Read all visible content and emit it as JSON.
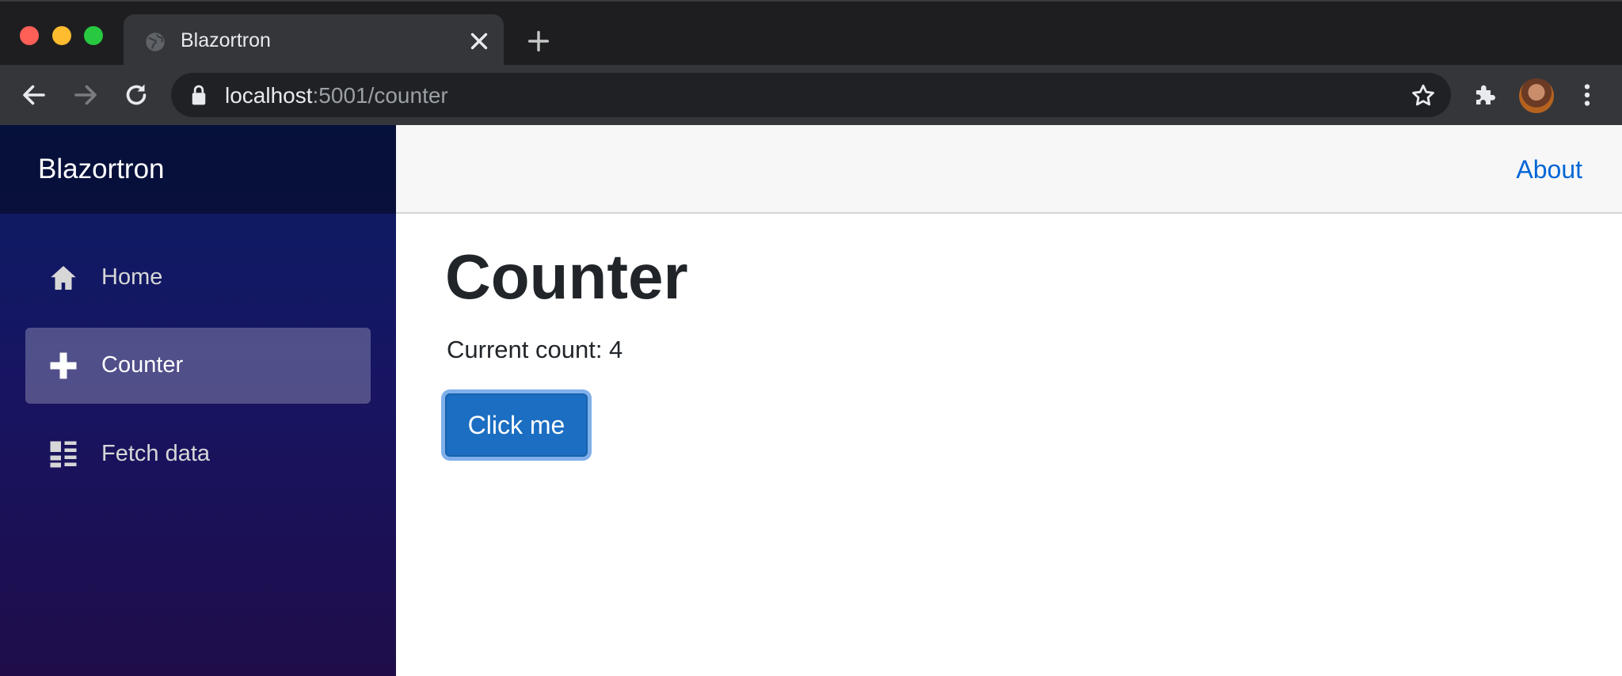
{
  "browser": {
    "tab_title": "Blazortron",
    "url_host": "localhost",
    "url_rest": ":5001/counter",
    "icons": {
      "favicon": "globe-icon",
      "close_tab": "close-icon",
      "new_tab": "plus-icon",
      "back": "arrow-left-icon",
      "forward": "arrow-right-icon",
      "reload": "reload-icon",
      "lock": "lock-icon",
      "bookmark": "star-icon",
      "extensions": "puzzle-icon",
      "menu": "kebab-menu-icon"
    }
  },
  "sidebar": {
    "brand": "Blazortron",
    "items": [
      {
        "label": "Home",
        "icon": "home-icon",
        "active": false
      },
      {
        "label": "Counter",
        "icon": "plus-icon",
        "active": true
      },
      {
        "label": "Fetch data",
        "icon": "list-icon",
        "active": false
      }
    ]
  },
  "topbar": {
    "about_label": "About"
  },
  "main": {
    "title": "Counter",
    "count_line": "Current count: 4",
    "button_label": "Click me"
  },
  "colors": {
    "accent": "#1b6ec2",
    "link": "#0366d6",
    "sidebar_top": "#0a1d63",
    "sidebar_bottom": "#1f0d4a"
  }
}
